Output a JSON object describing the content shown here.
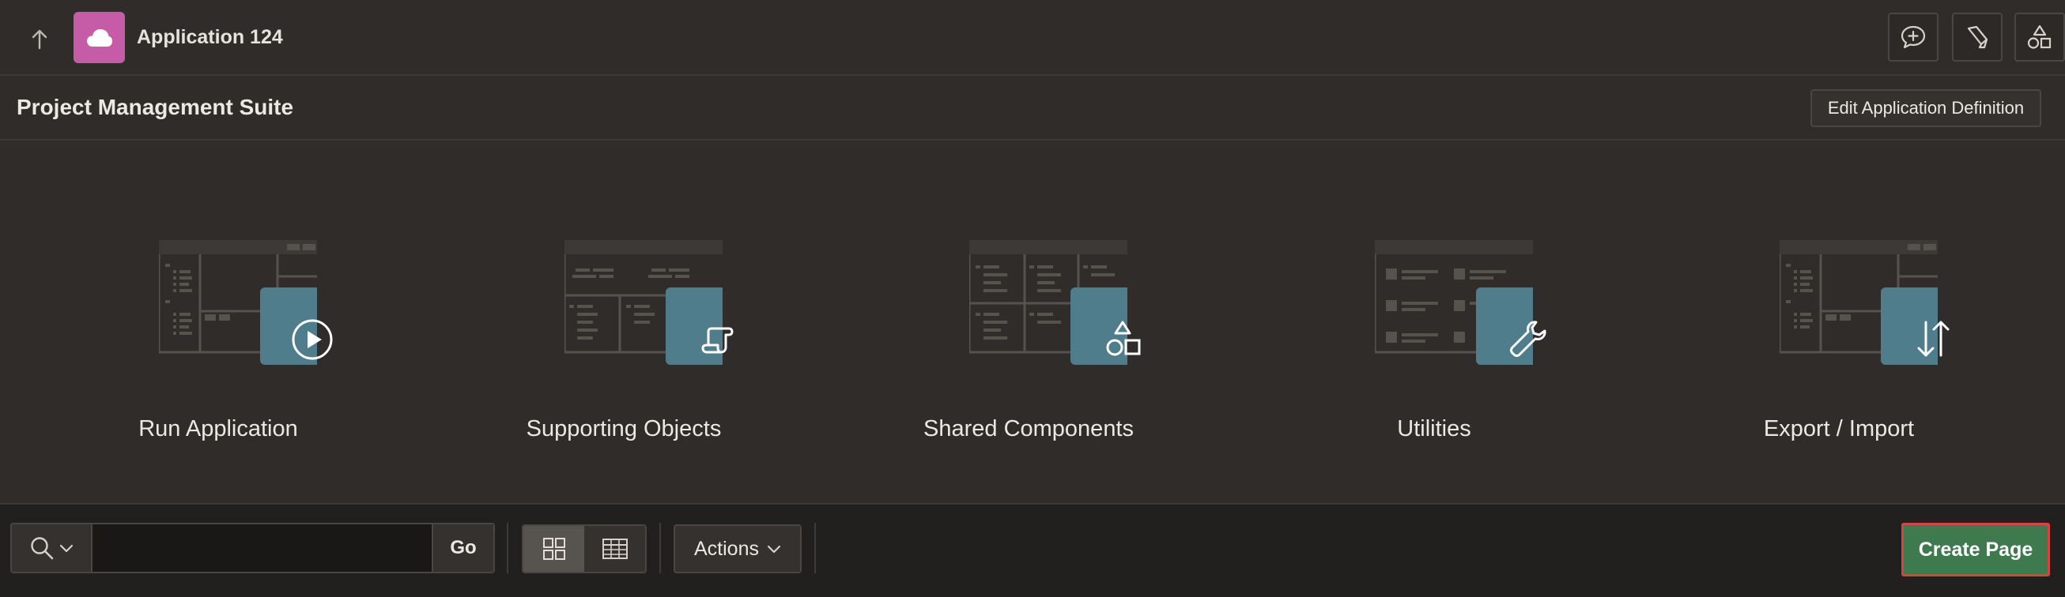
{
  "header": {
    "up_icon": "arrow-up-icon",
    "app_icon": "cloud-icon",
    "app_title": "Application 124",
    "tools": [
      {
        "name": "feedback-button",
        "icon": "chat-plus-icon"
      },
      {
        "name": "highlighter-button",
        "icon": "highlighter-icon"
      },
      {
        "name": "shapes-button",
        "icon": "shapes-icon"
      }
    ]
  },
  "title_region": {
    "title": "Project Management Suite",
    "edit_button": "Edit Application Definition"
  },
  "tiles": [
    {
      "label": "Run Application",
      "icon": "play-icon"
    },
    {
      "label": "Supporting Objects",
      "icon": "scroll-icon"
    },
    {
      "label": "Shared Components",
      "icon": "shapes-icon"
    },
    {
      "label": "Utilities",
      "icon": "wrench-icon"
    },
    {
      "label": "Export / Import",
      "icon": "arrows-up-down-icon"
    }
  ],
  "toolbar": {
    "search_value": "",
    "go_label": "Go",
    "view_icons": [
      "grid-icon",
      "table-icon"
    ],
    "active_view": "grid",
    "actions_label": "Actions",
    "create_page_label": "Create Page"
  },
  "colors": {
    "background": "#2f2c29",
    "toolbar_bg": "#22201e",
    "app_badge": "#c65ca7",
    "tile_badge": "#4f7d8c",
    "create_button": "#3f7a4f",
    "create_button_border": "#d9433b"
  }
}
